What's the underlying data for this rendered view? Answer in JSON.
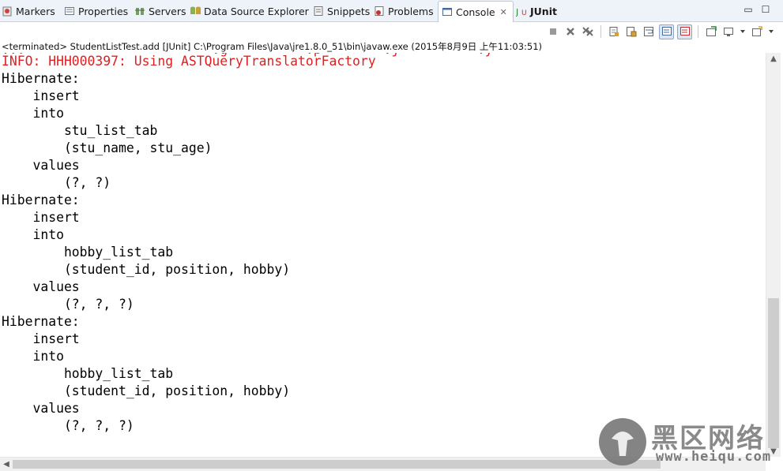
{
  "tabs": [
    {
      "label": "Markers",
      "icon": "markers-icon"
    },
    {
      "label": "Properties",
      "icon": "properties-icon"
    },
    {
      "label": "Servers",
      "icon": "servers-icon"
    },
    {
      "label": "Data Source Explorer",
      "icon": "data-source-icon"
    },
    {
      "label": "Snippets",
      "icon": "snippets-icon"
    },
    {
      "label": "Problems",
      "icon": "problems-icon"
    },
    {
      "label": "Console",
      "icon": "console-icon",
      "active": true,
      "close": "✕"
    },
    {
      "label": "JUnit",
      "icon": "junit-icon"
    }
  ],
  "window_controls": {
    "minimize": "▭",
    "maximize": "☐"
  },
  "status": "<terminated> StudentListTest.add [JUnit] C:\\Program Files\\Java\\jre1.8.0_51\\bin\\javaw.exe (2015年8月9日 上午11:03:51)",
  "console": {
    "cut_line": "...                        .g          .p        .j          .y",
    "lines": [
      {
        "text": "INFO: HHH000397: Using ASTQueryTranslatorFactory",
        "style": "error"
      },
      {
        "text": "Hibernate:"
      },
      {
        "text": "    insert"
      },
      {
        "text": "    into"
      },
      {
        "text": "        stu_list_tab"
      },
      {
        "text": "        (stu_name, stu_age)"
      },
      {
        "text": "    values"
      },
      {
        "text": "        (?, ?)"
      },
      {
        "text": "Hibernate:"
      },
      {
        "text": "    insert"
      },
      {
        "text": "    into"
      },
      {
        "text": "        hobby_list_tab"
      },
      {
        "text": "        (student_id, position, hobby)"
      },
      {
        "text": "    values"
      },
      {
        "text": "        (?, ?, ?)"
      },
      {
        "text": "Hibernate:"
      },
      {
        "text": "    insert"
      },
      {
        "text": "    into"
      },
      {
        "text": "        hobby_list_tab"
      },
      {
        "text": "        (student_id, position, hobby)"
      },
      {
        "text": "    values"
      },
      {
        "text": "        (?, ?, ?)"
      }
    ]
  },
  "watermark": {
    "title": "黑区网络",
    "url": "www.heiqu.com"
  },
  "colors": {
    "error_text": "#e02020",
    "tabbar_bg": "#eef3fa"
  }
}
